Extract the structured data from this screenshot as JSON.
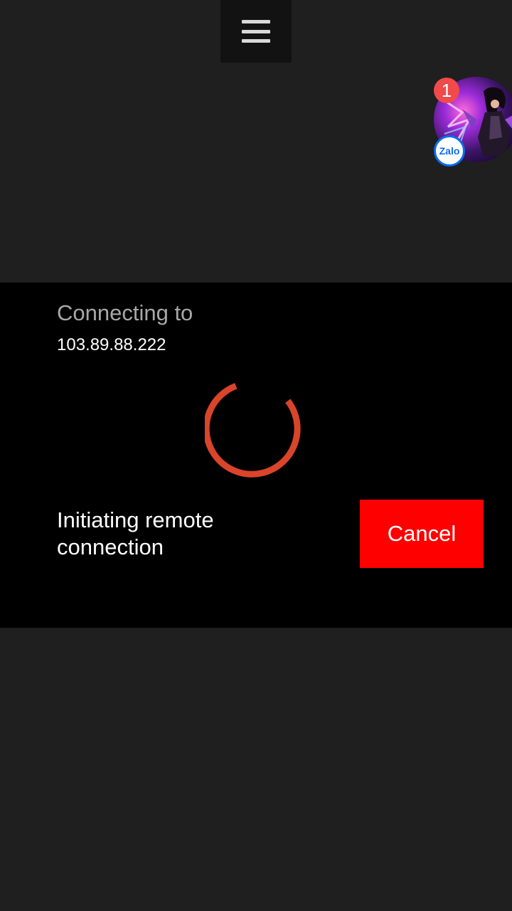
{
  "toolbar": {
    "menu_icon": "hamburger-menu-icon"
  },
  "chat_head": {
    "app": "Zalo",
    "badge_count": "1",
    "app_label": "Zalo"
  },
  "dialog": {
    "title": "Connecting to",
    "host": "103.89.88.222",
    "status": "Initiating remote connection",
    "cancel_label": "Cancel",
    "spinner_color": "#d9442a",
    "cancel_color": "#ff0000"
  }
}
